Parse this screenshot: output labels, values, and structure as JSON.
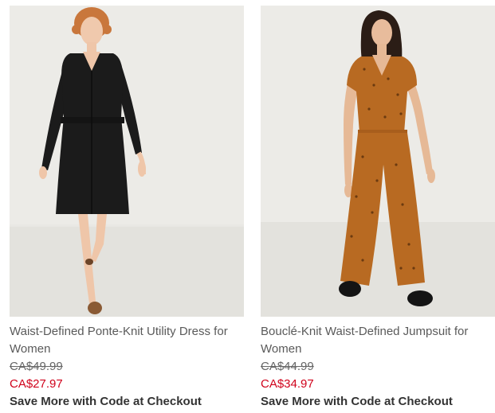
{
  "products": [
    {
      "name": "Waist-Defined Ponte-Knit Utility Dress for Women",
      "original_price": "CA$49.99",
      "sale_price": "CA$27.97",
      "promo": "Save More with Code at Checkout",
      "garment_color": "#1b1b1b"
    },
    {
      "name": "Bouclé-Knit Waist-Defined Jumpsuit for Women",
      "original_price": "CA$44.99",
      "sale_price": "CA$34.97",
      "promo": "Save More with Code at Checkout",
      "garment_color": "#b86a22"
    }
  ],
  "colors": {
    "sale": "#d0021b",
    "title": "#5a5a5a",
    "photo_background": "#ecebe7"
  }
}
